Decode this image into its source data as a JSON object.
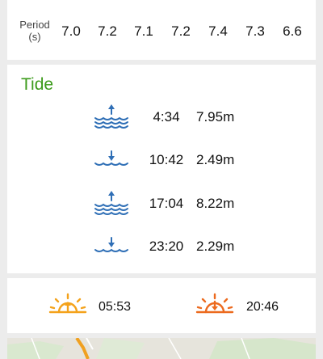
{
  "period": {
    "label_line1": "Period",
    "label_line2": "(s)",
    "values": [
      "7.0",
      "7.2",
      "7.1",
      "7.2",
      "7.4",
      "7.3",
      "6.6"
    ]
  },
  "tide": {
    "title": "Tide",
    "entries": [
      {
        "type": "high",
        "icon": "high-tide-icon",
        "time": "4:34",
        "height": "7.95m"
      },
      {
        "type": "low",
        "icon": "low-tide-icon",
        "time": "10:42",
        "height": "2.49m"
      },
      {
        "type": "high",
        "icon": "high-tide-icon",
        "time": "17:04",
        "height": "8.22m"
      },
      {
        "type": "low",
        "icon": "low-tide-icon",
        "time": "23:20",
        "height": "2.29m"
      }
    ]
  },
  "sun": {
    "sunrise": {
      "icon": "sunrise-icon",
      "time": "05:53"
    },
    "sunset": {
      "icon": "sunset-icon",
      "time": "20:46"
    }
  },
  "colors": {
    "tide_title": "#3d9b1c",
    "tide_icon": "#2f6fb6",
    "sunrise": "#f4a21b",
    "sunset": "#ec6a1e"
  }
}
